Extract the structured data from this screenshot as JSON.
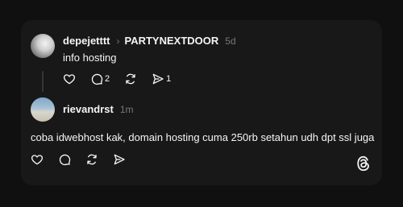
{
  "post1": {
    "username": "depejetttt",
    "replying_to": "PARTYNEXTDOOR",
    "timestamp": "5d",
    "text": "info hosting",
    "actions": {
      "like_icon": "heart-icon",
      "comment_icon": "comment-icon",
      "comment_count": "2",
      "repost_icon": "repost-icon",
      "share_icon": "send-icon",
      "share_count": "1"
    }
  },
  "post2": {
    "username": "rievandrst",
    "timestamp": "1m",
    "text": "coba idwebhost kak, domain hosting cuma 250rb setahun udh dpt ssl juga",
    "actions": {
      "like_icon": "heart-icon",
      "comment_icon": "comment-icon",
      "repost_icon": "repost-icon",
      "share_icon": "send-icon"
    }
  },
  "brand": {
    "logo_icon": "threads-logo-icon"
  },
  "colors": {
    "page_background": "#101010",
    "card_background": "#181818",
    "text_primary": "#f3f5f7",
    "text_muted": "#777777"
  }
}
